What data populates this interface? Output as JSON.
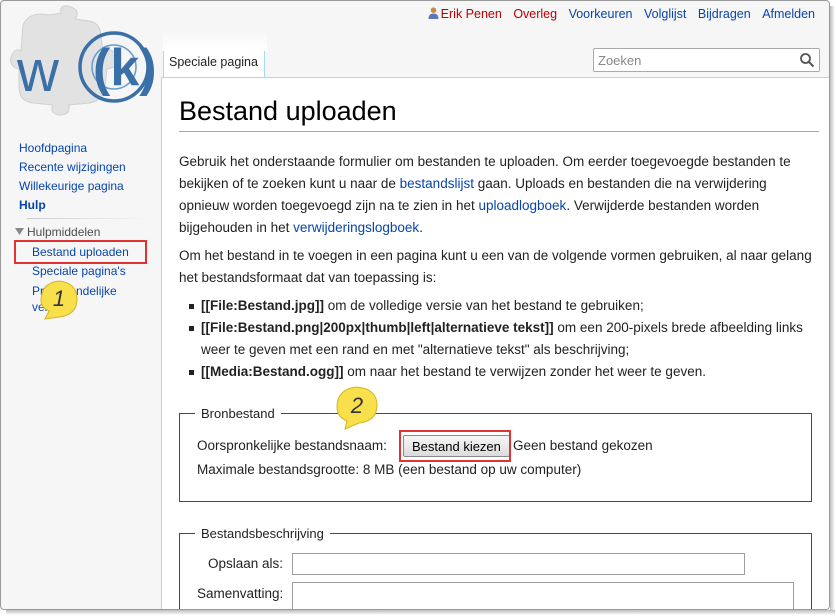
{
  "personal_tools": {
    "username": "Erik Penen",
    "talk": "Overleg",
    "preferences": "Voorkeuren",
    "watchlist": "Volglijst",
    "contributions": "Bijdragen",
    "logout": "Afmelden"
  },
  "tab": {
    "label": "Speciale pagina"
  },
  "search": {
    "placeholder": "Zoeken"
  },
  "navigation": {
    "items": [
      {
        "label": "Hoofdpagina"
      },
      {
        "label": "Recente wijzigingen"
      },
      {
        "label": "Willekeurige pagina"
      },
      {
        "label": "Hulp"
      }
    ]
  },
  "tools": {
    "heading": "Hulpmiddelen",
    "items": [
      {
        "label": "Bestand uploaden"
      },
      {
        "label": "Speciale pagina's"
      },
      {
        "label": "Printvriendelijke versie"
      }
    ]
  },
  "callouts": {
    "one": "1",
    "two": "2"
  },
  "page": {
    "title": "Bestand uploaden",
    "intro": {
      "t1": "Gebruik het onderstaande formulier om bestanden te uploaden. Om eerder toegevoegde bestanden te bekijken of te zoeken kunt u naar de ",
      "link1": "bestandslijst",
      "t2": " gaan. Uploads en bestanden die na verwijdering opnieuw worden toegevoegd zijn na te zien in het ",
      "link2": "uploadlogboek",
      "t3": ". Verwijderde bestanden worden bijgehouden in het ",
      "link3": "verwijderingslogboek",
      "t4": "."
    },
    "usage_intro": "Om het bestand in te voegen in een pagina kunt u een van de volgende vormen gebruiken, al naar gelang het bestandsformaat dat van toepassing is:",
    "usage": [
      {
        "code": "[[File:Bestand.jpg]]",
        "text": " om de volledige versie van het bestand te gebruiken;"
      },
      {
        "code": "[[File:Bestand.png|200px|thumb|left|alternatieve tekst]]",
        "text": " om een 200-pixels brede afbeelding links weer te geven met een rand en met \"alternatieve tekst\" als beschrijving;"
      },
      {
        "code": "[[Media:Bestand.ogg]]",
        "text": " om naar het bestand te verwijzen zonder het weer te geven."
      }
    ]
  },
  "source": {
    "legend": "Bronbestand",
    "file_label": "Oorspronkelijke bestandsnaam:",
    "choose_button": "Bestand kiezen",
    "no_file": "Geen bestand gekozen",
    "max_size": "Maximale bestandsgrootte: 8 MB (een bestand op uw computer)"
  },
  "description": {
    "legend": "Bestandsbeschrijving",
    "save_as_label": "Opslaan als:",
    "summary_label": "Samenvatting:"
  },
  "colors": {
    "link": "#0645ad",
    "highlight": "#e03434",
    "callout": "#f7e04b"
  }
}
